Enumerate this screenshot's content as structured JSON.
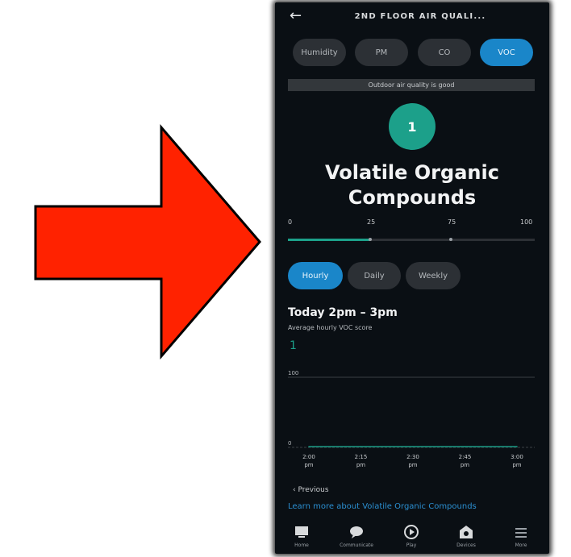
{
  "header": {
    "title": "2ND FLOOR AIR QUALI..."
  },
  "segments": [
    {
      "label": "Humidity",
      "active": false
    },
    {
      "label": "PM",
      "active": false
    },
    {
      "label": "CO",
      "active": false
    },
    {
      "label": "VOC",
      "active": true
    }
  ],
  "banner": "Outdoor air quality is good",
  "reading": {
    "index": "1",
    "title": "Volatile Organic Compounds"
  },
  "scale": {
    "ticks": [
      "0",
      "25",
      "75",
      "100"
    ],
    "level": 0.33
  },
  "tabs": [
    {
      "label": "Hourly",
      "active": true
    },
    {
      "label": "Daily",
      "active": false
    },
    {
      "label": "Weekly",
      "active": false
    }
  ],
  "period": {
    "title": "Today 2pm – 3pm",
    "subtitle": "Average hourly VOC score",
    "value": "1"
  },
  "chart_data": {
    "type": "line",
    "y_labels": [
      "100",
      "0"
    ],
    "x": [
      "2:00 pm",
      "2:15 pm",
      "2:30 pm",
      "2:45 pm",
      "3:00 pm"
    ],
    "values": [
      1,
      1,
      1,
      1,
      1
    ],
    "ylim": [
      0,
      100
    ]
  },
  "nav": {
    "previous": "Previous",
    "learn_more": "Learn more about Volatile Organic Compounds",
    "items": [
      {
        "label": "Home",
        "icon": "home-icon"
      },
      {
        "label": "Communicate",
        "icon": "chat-icon"
      },
      {
        "label": "Play",
        "icon": "play-icon"
      },
      {
        "label": "Devices",
        "icon": "devices-icon"
      },
      {
        "label": "More",
        "icon": "menu-icon"
      }
    ]
  },
  "colors": {
    "accent": "#1a86c9",
    "good": "#1ca08a",
    "arrow": "#ff2200"
  }
}
